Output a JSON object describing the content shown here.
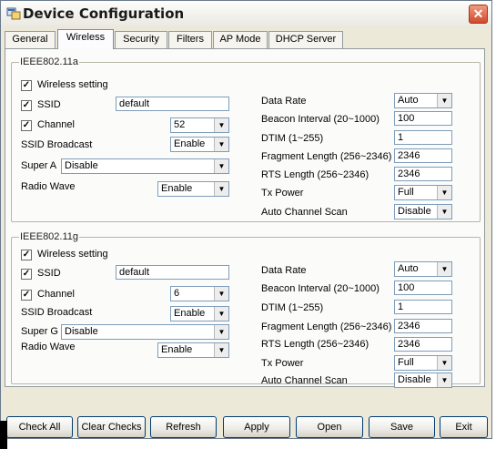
{
  "window": {
    "title": "Device Configuration",
    "close_symbol": "✕"
  },
  "tabs": [
    "General",
    "Wireless",
    "Security",
    "Filters",
    "AP Mode",
    "DHCP Server"
  ],
  "active_tab": "Wireless",
  "groups": [
    {
      "legend": "IEEE802.11a",
      "wireless_setting": {
        "label": "Wireless setting",
        "checked": true
      },
      "ssid": {
        "label": "SSID",
        "checked": true,
        "value": "default"
      },
      "channel": {
        "label": "Channel",
        "checked": true,
        "value": "52"
      },
      "ssid_broadcast": {
        "label": "SSID Broadcast",
        "value": "Enable"
      },
      "super_mode": {
        "label": "Super A",
        "value": "Disable"
      },
      "radio_wave": {
        "label": "Radio Wave",
        "value": "Enable"
      },
      "data_rate": {
        "label": "Data Rate",
        "value": "Auto"
      },
      "beacon_interval": {
        "label": "Beacon Interval (20~1000)",
        "value": "100"
      },
      "dtim": {
        "label": "DTIM (1~255)",
        "value": "1"
      },
      "fragment_length": {
        "label": "Fragment Length (256~2346)",
        "value": "2346"
      },
      "rts_length": {
        "label": "RTS Length (256~2346)",
        "value": "2346"
      },
      "tx_power": {
        "label": "Tx Power",
        "value": "Full"
      },
      "auto_channel_scan": {
        "label": "Auto Channel Scan",
        "value": "Disable"
      }
    },
    {
      "legend": "IEEE802.11g",
      "wireless_setting": {
        "label": "Wireless setting",
        "checked": true
      },
      "ssid": {
        "label": "SSID",
        "checked": true,
        "value": "default"
      },
      "channel": {
        "label": "Channel",
        "checked": true,
        "value": "6"
      },
      "ssid_broadcast": {
        "label": "SSID Broadcast",
        "value": "Enable"
      },
      "super_mode": {
        "label": "Super G",
        "value": "Disable"
      },
      "radio_wave": {
        "label": "Radio Wave",
        "value": "Enable"
      },
      "data_rate": {
        "label": "Data Rate",
        "value": "Auto"
      },
      "beacon_interval": {
        "label": "Beacon Interval (20~1000)",
        "value": "100"
      },
      "dtim": {
        "label": "DTIM (1~255)",
        "value": "1"
      },
      "fragment_length": {
        "label": "Fragment Length (256~2346)",
        "value": "2346"
      },
      "rts_length": {
        "label": "RTS Length (256~2346)",
        "value": "2346"
      },
      "tx_power": {
        "label": "Tx Power",
        "value": "Full"
      },
      "auto_channel_scan": {
        "label": "Auto Channel Scan",
        "value": "Disable"
      }
    }
  ],
  "buttons": {
    "check_all": "Check All",
    "clear_checks": "Clear Checks",
    "refresh": "Refresh",
    "apply": "Apply",
    "open": "Open",
    "save": "Save",
    "exit": "Exit"
  },
  "icons": {
    "app": "app-window-icon",
    "close": "close-icon",
    "dropdown": "dropdown-arrow-icon",
    "check": "checkmark-icon"
  },
  "glyphs": {
    "check": "✓",
    "arrow": "▼"
  },
  "colors": {
    "close_button": "#d1492a",
    "active_tab_border": "#7b8da4",
    "input_border": "#7f9db9"
  }
}
